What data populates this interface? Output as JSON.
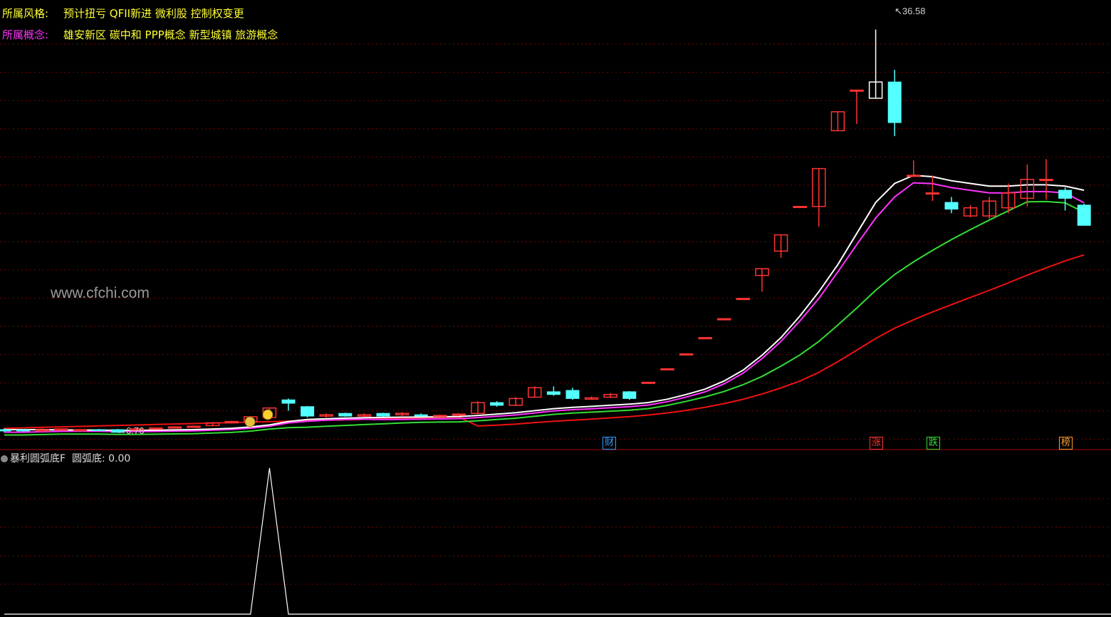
{
  "info": {
    "style_label": "所属风格:",
    "style_value": "预计扭亏 QFII新进 微利股 控制权变更",
    "concept_label": "所属概念:",
    "concept_value": "雄安新区 碳中和 PPP概念 新型城镇 旅游概念"
  },
  "watermark": "www.cfchi.com",
  "price_labels": {
    "high": "36.58",
    "low": "6.76"
  },
  "badges": [
    {
      "text": "财",
      "color": "#3399ff"
    },
    {
      "text": "涨",
      "color": "#ff3333"
    },
    {
      "text": "跌",
      "color": "#33dd33"
    },
    {
      "text": "榜",
      "color": "#ff9933"
    }
  ],
  "indicator": {
    "name": "暴利圆弧底F",
    "series_label": "圆弧底:",
    "series_value": "0.00",
    "signal_values": [
      0,
      0,
      0,
      0,
      0,
      0,
      0,
      0,
      0,
      0,
      0,
      0,
      0,
      0,
      1,
      0,
      0,
      0,
      0,
      0,
      0,
      0,
      0,
      0,
      0,
      0,
      0,
      0,
      0,
      0,
      0,
      0,
      0,
      0,
      0,
      0,
      0,
      0,
      0,
      0,
      0,
      0,
      0,
      0,
      0,
      0,
      0,
      0,
      0,
      0,
      0,
      0,
      0,
      0,
      0,
      0,
      0,
      0,
      0,
      0
    ]
  },
  "colors": {
    "up": "#ff3333",
    "down": "#54ffff",
    "ma1": "#ffffff",
    "ma2": "#ff33ff",
    "ma3": "#33dd33",
    "ma4": "#ee1111",
    "grid": "#7a0000",
    "divider": "#aa0000"
  },
  "chart_data": {
    "type": "candlestick",
    "ylim": [
      6.0,
      38.5
    ],
    "high_marker": 36.58,
    "low_marker": 6.76,
    "candles": [
      [
        7.0,
        6.9,
        7.1,
        6.8
      ],
      [
        7.0,
        6.9,
        7.05,
        6.85
      ],
      [
        6.9,
        7.0,
        7.1,
        6.85
      ],
      [
        7.0,
        7.05,
        7.1,
        6.95
      ],
      [
        7.0,
        7.0,
        7.05,
        6.95
      ],
      [
        7.0,
        6.95,
        7.05,
        6.9
      ],
      [
        7.0,
        6.8,
        7.05,
        6.76
      ],
      [
        7.0,
        7.05,
        7.1,
        6.95
      ],
      [
        7.1,
        7.12,
        7.15,
        7.08
      ],
      [
        7.15,
        7.2,
        7.25,
        7.1
      ],
      [
        7.2,
        7.25,
        7.3,
        7.15
      ],
      [
        7.3,
        7.5,
        7.55,
        7.25
      ],
      [
        7.5,
        7.6,
        7.65,
        7.45
      ],
      [
        7.6,
        7.95,
        8.0,
        7.55
      ],
      [
        7.9,
        8.6,
        8.65,
        7.85
      ],
      [
        9.2,
        8.95,
        9.3,
        8.4
      ],
      [
        8.7,
        8.0,
        8.75,
        7.9
      ],
      [
        8.0,
        8.1,
        8.2,
        7.9
      ],
      [
        8.2,
        8.0,
        8.25,
        7.95
      ],
      [
        8.0,
        8.1,
        8.2,
        7.95
      ],
      [
        8.2,
        8.0,
        8.25,
        7.95
      ],
      [
        8.1,
        8.2,
        8.3,
        8.0
      ],
      [
        8.1,
        8.0,
        8.2,
        7.95
      ],
      [
        8.0,
        8.05,
        8.1,
        7.95
      ],
      [
        8.1,
        8.15,
        8.2,
        8.0
      ],
      [
        8.2,
        9.0,
        9.1,
        8.15
      ],
      [
        9.0,
        8.8,
        9.1,
        8.7
      ],
      [
        8.8,
        9.3,
        9.4,
        8.75
      ],
      [
        9.4,
        10.1,
        10.2,
        9.35
      ],
      [
        9.8,
        9.6,
        10.2,
        9.5
      ],
      [
        9.9,
        9.3,
        10.1,
        9.2
      ],
      [
        9.25,
        9.35,
        9.45,
        9.2
      ],
      [
        9.4,
        9.6,
        9.7,
        9.35
      ],
      [
        9.8,
        9.3,
        9.85,
        9.2
      ],
      [
        10.5,
        10.5,
        10.5,
        10.5
      ],
      [
        11.5,
        11.5,
        11.5,
        11.5
      ],
      [
        12.6,
        12.6,
        12.6,
        12.6
      ],
      [
        13.8,
        13.8,
        13.8,
        13.8
      ],
      [
        15.2,
        15.2,
        15.2,
        15.2
      ],
      [
        16.7,
        16.7,
        16.7,
        16.7
      ],
      [
        18.4,
        18.9,
        18.9,
        17.2
      ],
      [
        20.2,
        21.4,
        21.4,
        19.7
      ],
      [
        23.5,
        23.5,
        23.5,
        23.5
      ],
      [
        23.5,
        26.3,
        26.3,
        22.0
      ],
      [
        29.1,
        30.5,
        30.5,
        29.1
      ],
      [
        32.1,
        32.1,
        32.1,
        29.6
      ],
      [
        31.5,
        32.7,
        36.58,
        31.5
      ],
      [
        32.7,
        29.7,
        33.6,
        28.7
      ],
      [
        25.8,
        25.8,
        26.9,
        25.8
      ],
      [
        24.5,
        24.5,
        25.8,
        23.9
      ],
      [
        23.8,
        23.3,
        24.2,
        23.0
      ],
      [
        22.8,
        23.4,
        23.6,
        22.7
      ],
      [
        22.8,
        23.9,
        24.2,
        22.6
      ],
      [
        23.4,
        24.5,
        25.2,
        23.0
      ],
      [
        24.1,
        25.5,
        26.6,
        23.5
      ],
      [
        25.5,
        25.5,
        27.0,
        24.0
      ],
      [
        24.7,
        24.1,
        24.9,
        23.2
      ],
      [
        23.6,
        22.1,
        23.7,
        22.1
      ]
    ],
    "ma_white": [
      7.0,
      7.0,
      7.0,
      6.98,
      6.97,
      6.97,
      6.95,
      6.95,
      6.96,
      6.98,
      7.0,
      7.05,
      7.1,
      7.2,
      7.35,
      7.6,
      7.75,
      7.8,
      7.85,
      7.88,
      7.9,
      7.92,
      7.93,
      7.95,
      7.97,
      8.05,
      8.15,
      8.25,
      8.4,
      8.55,
      8.65,
      8.72,
      8.8,
      8.88,
      9.0,
      9.25,
      9.6,
      10.0,
      10.6,
      11.4,
      12.5,
      13.8,
      15.4,
      17.2,
      19.2,
      21.5,
      23.8,
      25.2,
      25.8,
      25.7,
      25.4,
      25.2,
      25.0,
      25.0,
      25.1,
      25.1,
      25.0,
      24.7
    ]
  }
}
